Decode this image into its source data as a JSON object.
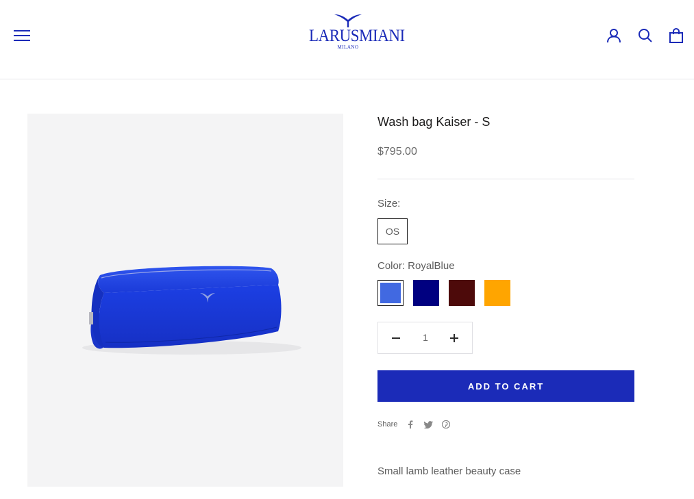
{
  "header": {
    "logo_text": "LARUSMIANI",
    "logo_sub": "MILANO",
    "menu_icon": "hamburger-menu-icon",
    "account_icon": "user-icon",
    "search_icon": "search-icon",
    "cart_icon": "shopping-bag-icon",
    "brand_color": "#1b2bb8"
  },
  "product": {
    "title": "Wash bag Kaiser - S",
    "price": "$795.00",
    "size_label": "Size:",
    "size_option": "OS",
    "color_label": "Color: RoyalBlue",
    "swatches": [
      {
        "name": "RoyalBlue",
        "color": "#4169e1",
        "selected": true
      },
      {
        "name": "Navy",
        "color": "#000080",
        "selected": false
      },
      {
        "name": "Maroon",
        "color": "#4d0a0a",
        "selected": false
      },
      {
        "name": "Orange",
        "color": "#ffa500",
        "selected": false
      }
    ],
    "quantity": "1",
    "add_to_cart": "ADD TO CART",
    "share_label": "Share",
    "share_icons": [
      "facebook-icon",
      "twitter-icon",
      "pinterest-icon"
    ],
    "description": "Small lamb leather beauty case",
    "image_alt_color": "#1a3ee0"
  }
}
